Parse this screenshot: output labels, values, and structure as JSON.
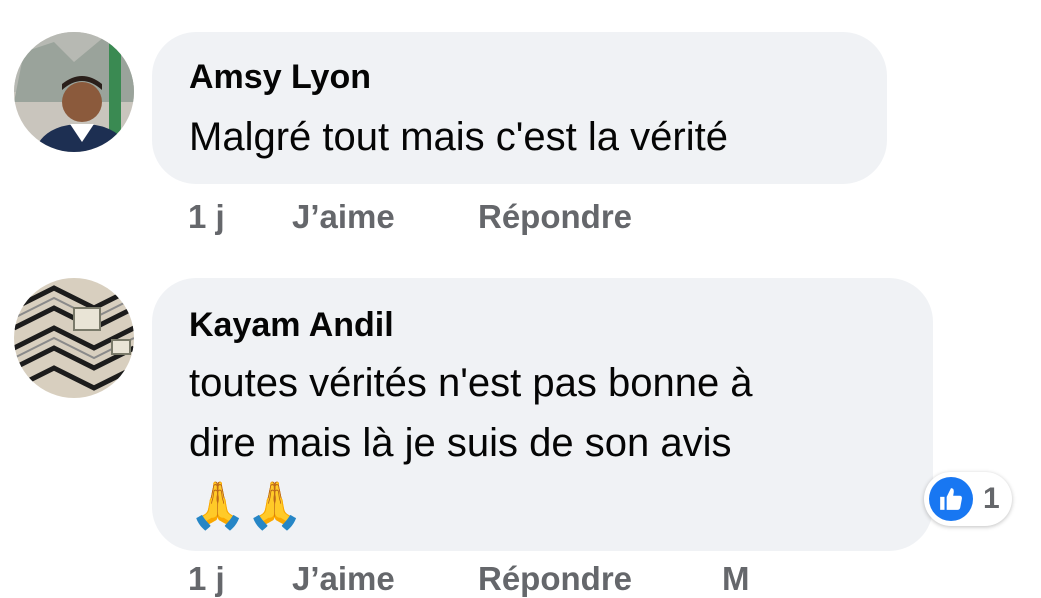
{
  "comments": [
    {
      "author": "Amsy Lyon",
      "lines": [
        "Malgré tout mais c'est la vérité"
      ],
      "time": "1 j",
      "like_label": "J’aime",
      "reply_label": "Répondre"
    },
    {
      "author": "Kayam Andil",
      "lines": [
        "toutes vérités n'est pas bonne à",
        "dire mais là je suis de son avis"
      ],
      "emojis": "🙏🙏",
      "reaction_count": "1",
      "time": "1 j",
      "like_label": "J’aime",
      "reply_label": "Répondre",
      "more_label": "M"
    }
  ],
  "colors": {
    "bubble": "#f0f2f5",
    "meta_text": "#65676b",
    "like_blue": "#1877f2"
  }
}
